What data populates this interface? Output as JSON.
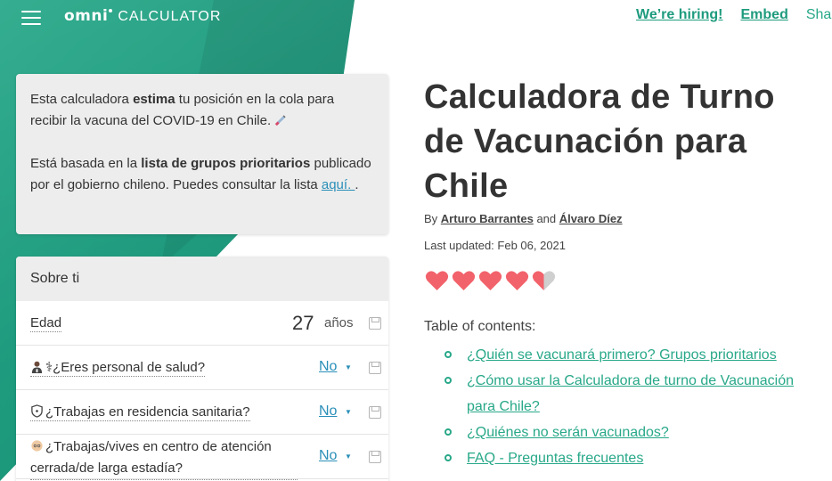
{
  "header": {
    "logo_text": "omni",
    "logo_sub": "CALCULATOR",
    "links": [
      "We’re hiring!",
      "Embed"
    ],
    "share": "Shar"
  },
  "info_card": {
    "p1_a": "Esta calculadora ",
    "p1_b": "estima",
    "p1_c": " tu posición en la cola para recibir la vacuna del COVID-19 en Chile. ",
    "p2_a": "Está basada en la ",
    "p2_b": "lista de grupos prioritarios",
    "p2_c": " publicado por el gobierno chileno. Puedes consultar la lista ",
    "p2_link": "aquí. ",
    "p2_d": "."
  },
  "calculator": {
    "section_title": "Sobre ti",
    "rows": [
      {
        "label": "Edad",
        "value": "27",
        "unit": "años"
      },
      {
        "label": "⚕¿Eres personal de salud?",
        "selected": "No"
      },
      {
        "label": "¿Trabajas en residencia sanitaria?",
        "selected": "No"
      },
      {
        "label": "¿Trabajas/vives en centro de atención cerrada/de larga estadía?",
        "selected": "No"
      }
    ]
  },
  "article": {
    "title": "Calculadora de Turno de Vacunación para Chile",
    "by": "By ",
    "author1": "Arturo Barrantes",
    "and": " and ",
    "author2": "Álvaro Díez",
    "updated": "Last updated: Feb 06, 2021",
    "rating": 4.5,
    "toc_title": "Table of contents:",
    "toc": [
      "¿Quién se vacunará primero? Grupos prioritarios",
      "¿Cómo usar la Calculadora de turno de Vacunación para Chile?",
      "¿Quiénes no serán vacunados?",
      "FAQ - Preguntas frecuentes"
    ]
  },
  "colors": {
    "brand": "#28a889",
    "link": "#2a8fb8",
    "heart": "#f2626b"
  },
  "icons": [
    "menu-icon",
    "syringe-icon",
    "health-worker-icon",
    "shield-icon",
    "elder-icon",
    "save-icon",
    "heart-icon"
  ]
}
